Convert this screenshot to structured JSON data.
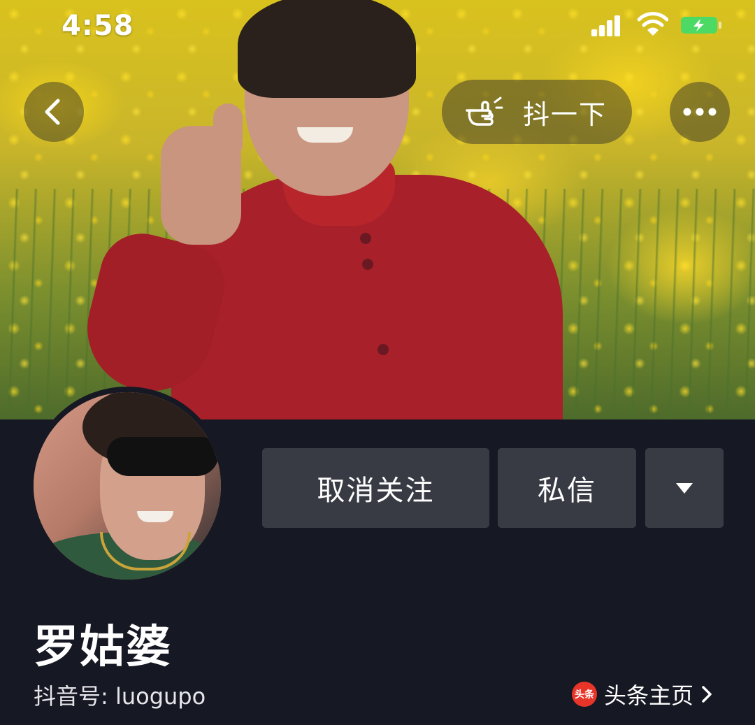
{
  "status_bar": {
    "time": "4:58"
  },
  "header": {
    "shake_label": "抖一下"
  },
  "actions": {
    "unfollow_label": "取消关注",
    "message_label": "私信"
  },
  "profile": {
    "name": "罗姑婆",
    "douyin_id": "抖音号: luogupo",
    "toutiao_badge": "头条",
    "toutiao_label": "头条主页"
  },
  "icons": [
    "back-chevron-icon",
    "hand-pointer-icon",
    "more-dots-icon",
    "signal-icon",
    "wifi-icon",
    "battery-icon",
    "dropdown-triangle-icon",
    "chevron-right-icon"
  ],
  "colors": {
    "background": "#161823",
    "button": "#393b44",
    "battery": "#4cd964",
    "toutiao": "#e8352a"
  }
}
